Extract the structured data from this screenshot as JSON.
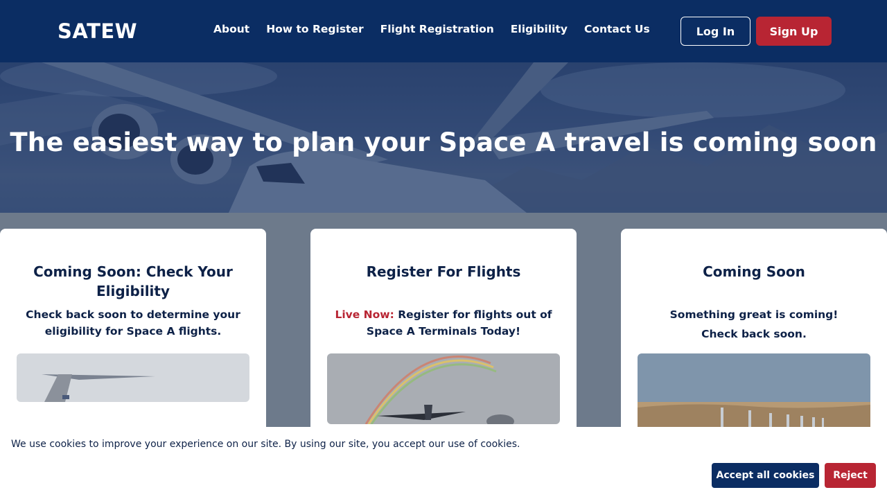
{
  "header": {
    "logo": "SATEW",
    "nav": [
      "About",
      "How to Register",
      "Flight Registration",
      "Eligibility",
      "Contact Us"
    ],
    "login_label": "Log In",
    "signup_label": "Sign Up"
  },
  "hero": {
    "title": "The easiest way to plan your Space A travel is coming soon"
  },
  "cards": [
    {
      "title": "Coming Soon: Check Your Eligibility",
      "text": "Check back soon to determine your eligibility for Space A flights."
    },
    {
      "title": "Register For Flights",
      "live_label": "Live Now:",
      "text": "Register for flights out of Space A Terminals Today!"
    },
    {
      "title": "Coming Soon",
      "line1": "Something great is coming!",
      "line2": "Check back soon."
    }
  ],
  "cookie_banner": {
    "text": "We use cookies to improve your experience on our site. By using our site, you accept our use of cookies.",
    "accept_label": "Accept all cookies",
    "reject_label": "Reject"
  },
  "colors": {
    "navy": "#0b2d63",
    "red": "#b82533",
    "text": "#0d2147"
  }
}
